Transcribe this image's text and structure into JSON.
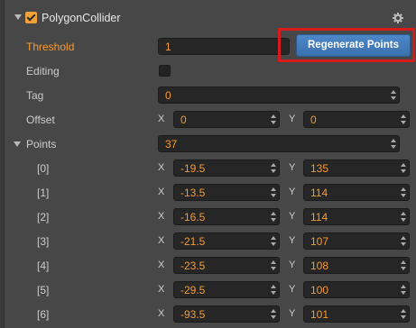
{
  "component": {
    "title": "PolygonCollider",
    "enabled": true
  },
  "threshold": {
    "label": "Threshold",
    "value": "1"
  },
  "regenerate_label": "Regenerate Points",
  "editing": {
    "label": "Editing",
    "checked": false
  },
  "tag": {
    "label": "Tag",
    "value": "0"
  },
  "offset": {
    "label": "Offset",
    "x": "0",
    "y": "0"
  },
  "axes": {
    "x": "X",
    "y": "Y"
  },
  "points": {
    "label": "Points",
    "count": "37",
    "items": [
      {
        "index": "[0]",
        "x": "-19.5",
        "y": "135"
      },
      {
        "index": "[1]",
        "x": "-13.5",
        "y": "114"
      },
      {
        "index": "[2]",
        "x": "-16.5",
        "y": "114"
      },
      {
        "index": "[3]",
        "x": "-21.5",
        "y": "107"
      },
      {
        "index": "[4]",
        "x": "-23.5",
        "y": "108"
      },
      {
        "index": "[5]",
        "x": "-29.5",
        "y": "100"
      },
      {
        "index": "[6]",
        "x": "-93.5",
        "y": "101"
      }
    ]
  },
  "colors": {
    "accent": "#f59b32",
    "button": "#3b71ae",
    "highlight": "#d91a1a"
  }
}
